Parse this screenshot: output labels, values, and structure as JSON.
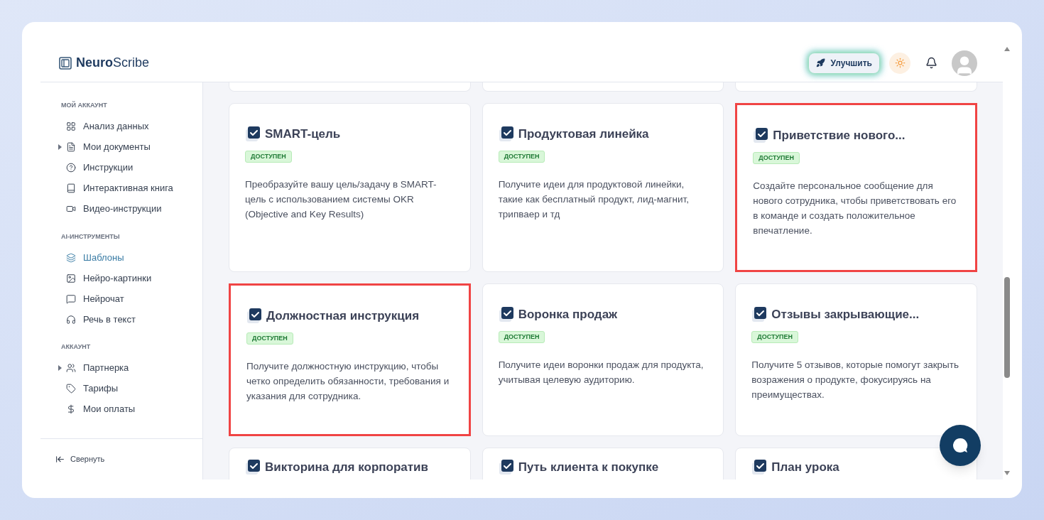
{
  "header": {
    "logo": {
      "bold": "Neuro",
      "light": "Scribe"
    },
    "upgrade_button": "Улучшить"
  },
  "sidebar": {
    "sections": [
      {
        "title": "МОЙ АККАУНТ",
        "items": [
          {
            "label": "Анализ данных",
            "expandable": false,
            "selected": false
          },
          {
            "label": "Мои документы",
            "expandable": true,
            "selected": false
          },
          {
            "label": "Инструкции",
            "expandable": false,
            "selected": false
          },
          {
            "label": "Интерактивная книга",
            "expandable": false,
            "selected": false
          },
          {
            "label": "Видео-инструкции",
            "expandable": false,
            "selected": false
          }
        ]
      },
      {
        "title": "AI-ИНСТРУМЕНТЫ",
        "items": [
          {
            "label": "Шаблоны",
            "expandable": false,
            "selected": true
          },
          {
            "label": "Нейро-картинки",
            "expandable": false,
            "selected": false
          },
          {
            "label": "Нейрочат",
            "expandable": false,
            "selected": false
          },
          {
            "label": "Речь в текст",
            "expandable": false,
            "selected": false
          }
        ]
      },
      {
        "title": "АККАУНТ",
        "items": [
          {
            "label": "Партнерка",
            "expandable": true,
            "selected": false
          },
          {
            "label": "Тарифы",
            "expandable": false,
            "selected": false
          },
          {
            "label": "Мои оплаты",
            "expandable": false,
            "selected": false
          }
        ]
      }
    ],
    "collapse": "Свернуть"
  },
  "cards": [
    {
      "title": "SMART-цель",
      "badge": "ДОСТУПЕН",
      "description": "Преобразуйте вашу цель/задачу в SMART-цель с использованием системы OKR (Objective and Key Results)",
      "highlighted": false
    },
    {
      "title": "Продуктовая линейка",
      "badge": "ДОСТУПЕН",
      "description": "Получите идеи для продуктовой линейки, такие как бесплатный продукт, лид-магнит, трипваер и тд",
      "highlighted": false
    },
    {
      "title": "Приветствие нового...",
      "badge": "ДОСТУПЕН",
      "description": "Создайте персональное сообщение для нового сотрудника, чтобы приветствовать его в команде и создать положительное впечатление.",
      "highlighted": true
    },
    {
      "title": "Должностная инструкция",
      "badge": "ДОСТУПЕН",
      "description": "Получите должностную инструкцию, чтобы четко определить обязанности, требования и указания для сотрудника.",
      "highlighted": true
    },
    {
      "title": "Воронка продаж",
      "badge": "ДОСТУПЕН",
      "description": "Получите идеи воронки продаж для продукта, учитывая целевую аудиторию.",
      "highlighted": false
    },
    {
      "title": "Отзывы закрывающие...",
      "badge": "ДОСТУПЕН",
      "description": "Получите 5 отзывов, которые помогут закрыть возражения о продукте, фокусируясь на преимуществах.",
      "highlighted": false
    },
    {
      "title": "Викторина для корпоратив",
      "highlighted": false
    },
    {
      "title": "Путь клиента к покупке",
      "highlighted": false
    },
    {
      "title": "План урока",
      "highlighted": false
    }
  ]
}
